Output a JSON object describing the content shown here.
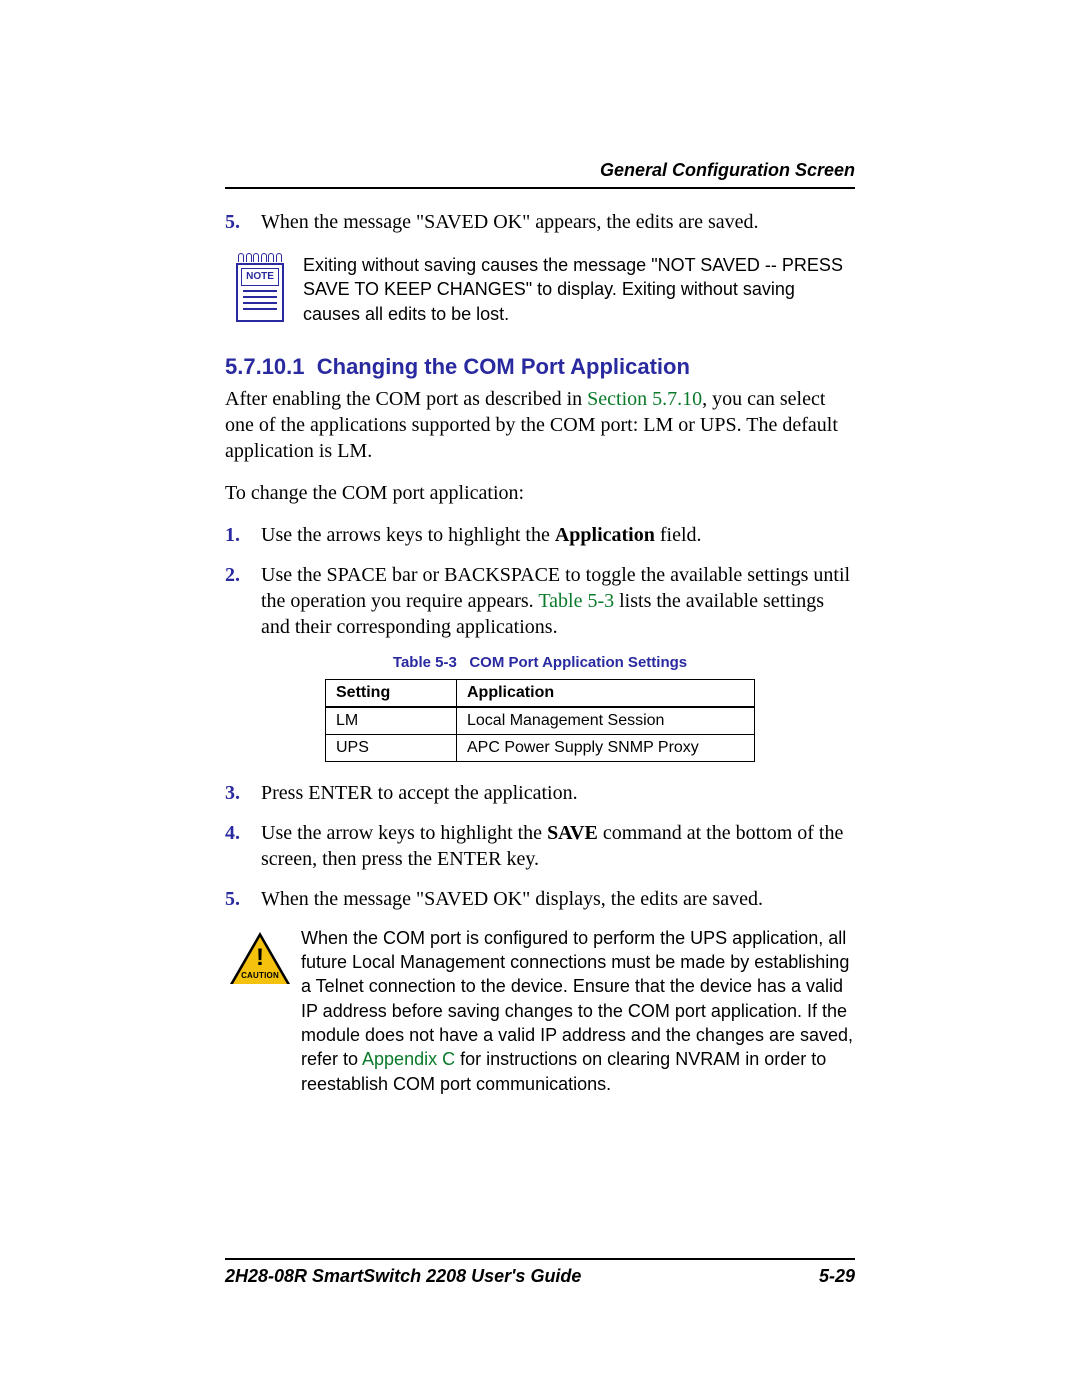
{
  "header": {
    "running_head": "General Configuration Screen"
  },
  "top_list": {
    "item5_num": "5.",
    "item5_text": "When the message \"SAVED OK\" appears, the edits are saved."
  },
  "note": {
    "label": "NOTE",
    "text": "Exiting without saving causes the message \"NOT SAVED -- PRESS SAVE TO KEEP CHANGES\" to display. Exiting without saving causes all edits to be lost."
  },
  "section": {
    "number": "5.7.10.1",
    "title": "Changing the COM Port Application",
    "intro_pre": "After enabling the COM port as described in ",
    "intro_link": "Section 5.7.10",
    "intro_post": ", you can select one of the applications supported by the COM port: LM or UPS. The default application is LM.",
    "lead": "To change the COM port application:"
  },
  "steps": {
    "s1_num": "1.",
    "s1_pre": "Use the arrows keys to highlight the ",
    "s1_bold": "Application",
    "s1_post": " field.",
    "s2_num": "2.",
    "s2_pre": "Use the SPACE bar or BACKSPACE to toggle the available settings until the operation you require appears. ",
    "s2_link": "Table 5-3",
    "s2_post": " lists the available settings and their corresponding applications.",
    "s3_num": "3.",
    "s3_text": "Press ENTER to accept the application.",
    "s4_num": "4.",
    "s4_pre": "Use the arrow keys to highlight the ",
    "s4_bold": "SAVE",
    "s4_post": " command at the bottom of the screen, then press the ENTER key.",
    "s5_num": "5.",
    "s5_text": "When the message \"SAVED OK\" displays, the edits are saved."
  },
  "table": {
    "caption_label": "Table 5-3",
    "caption_title": "COM Port Application Settings",
    "head_setting": "Setting",
    "head_application": "Application",
    "rows": [
      {
        "setting": "LM",
        "application": "Local Management Session"
      },
      {
        "setting": "UPS",
        "application": "APC Power Supply SNMP Proxy"
      }
    ]
  },
  "caution": {
    "bang": "!",
    "label": "CAUTION",
    "pre": "When the COM port is configured to perform the UPS application, all future Local Management connections must be made by establishing a Telnet connection to the device. Ensure that the device has a valid IP address before saving changes to the COM port application. If the module does not have a valid IP address and the changes are saved, refer to ",
    "link": "Appendix C",
    "post": " for instructions on clearing NVRAM in order to reestablish COM port communications."
  },
  "footer": {
    "left": "2H28-08R SmartSwitch 2208 User's Guide",
    "right": "5-29"
  }
}
